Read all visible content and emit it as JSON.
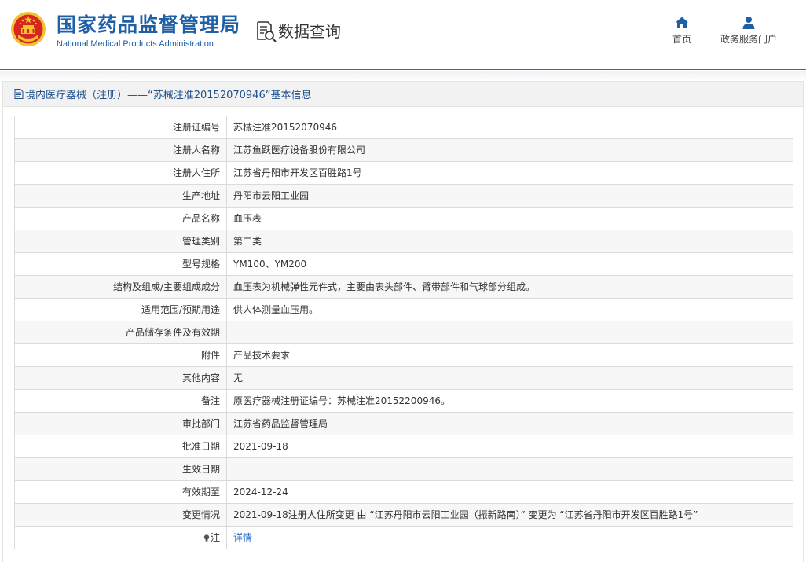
{
  "header": {
    "logo_cn": "国家药品监督管理局",
    "logo_en": "National Medical Products Administration",
    "query_label": "数据查询",
    "nav": [
      {
        "label": "首页",
        "icon": "home-icon"
      },
      {
        "label": "政务服务门户",
        "icon": "user-icon"
      }
    ]
  },
  "panel": {
    "title": "境内医疗器械（注册）——“苏械注准20152070946”基本信息"
  },
  "rows": [
    {
      "label": "注册证编号",
      "value": "苏械注准20152070946"
    },
    {
      "label": "注册人名称",
      "value": "江苏鱼跃医疗设备股份有限公司"
    },
    {
      "label": "注册人住所",
      "value": "江苏省丹阳市开发区百胜路1号"
    },
    {
      "label": "生产地址",
      "value": "丹阳市云阳工业园"
    },
    {
      "label": "产品名称",
      "value": "血压表"
    },
    {
      "label": "管理类别",
      "value": "第二类"
    },
    {
      "label": "型号规格",
      "value": "YM100、YM200"
    },
    {
      "label": "结构及组成/主要组成成分",
      "value": "血压表为机械弹性元件式，主要由表头部件、臂带部件和气球部分组成。"
    },
    {
      "label": "适用范围/预期用途",
      "value": "供人体测量血压用。"
    },
    {
      "label": "产品储存条件及有效期",
      "value": ""
    },
    {
      "label": "附件",
      "value": "产品技术要求"
    },
    {
      "label": "其他内容",
      "value": "无"
    },
    {
      "label": "备注",
      "value": "原医疗器械注册证编号：苏械注准20152200946。"
    },
    {
      "label": "审批部门",
      "value": "江苏省药品监督管理局"
    },
    {
      "label": "批准日期",
      "value": "2021-09-18"
    },
    {
      "label": "生效日期",
      "value": ""
    },
    {
      "label": "有效期至",
      "value": "2024-12-24"
    },
    {
      "label": "变更情况",
      "value": "2021-09-18注册人住所变更 由 “江苏丹阳市云阳工业园（振新路南）” 变更为 “江苏省丹阳市开发区百胜路1号”"
    }
  ],
  "note": {
    "label": "注",
    "link": "详情",
    "icon": "bulb-icon"
  },
  "colors": {
    "brand_blue": "#1f5fa6",
    "link_blue": "#1f6fc5",
    "emblem_red": "#d7261e",
    "emblem_gold": "#f2c230"
  }
}
